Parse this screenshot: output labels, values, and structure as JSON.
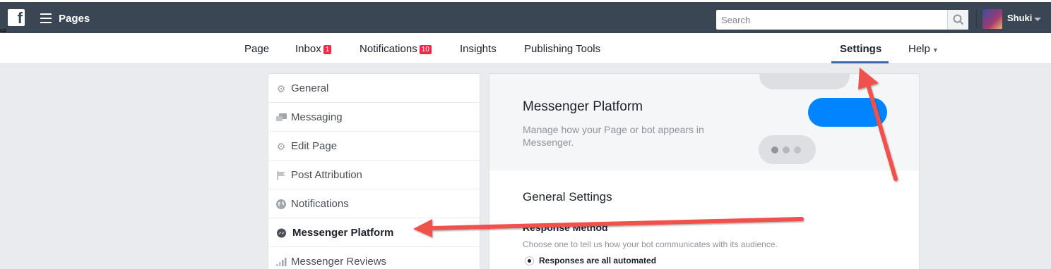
{
  "topbar": {
    "logo": "facebook-logo",
    "menu_icon": "hamburger-icon",
    "title": "Pages",
    "search_placeholder": "Search",
    "search_icon": "search-icon",
    "user_name": "Shuki",
    "user_caret_icon": "caret-down-icon"
  },
  "subnav": {
    "items": [
      {
        "label": "Page"
      },
      {
        "label": "Inbox",
        "badge": "1"
      },
      {
        "label": "Notifications",
        "badge": "10"
      },
      {
        "label": "Insights"
      },
      {
        "label": "Publishing Tools"
      },
      {
        "label": "Settings",
        "active": true
      },
      {
        "label": "Help"
      }
    ]
  },
  "sidebar": {
    "items": [
      {
        "label": "General",
        "icon": "gear-icon"
      },
      {
        "label": "Messaging",
        "icon": "chat-bubbles-icon"
      },
      {
        "label": "Edit Page",
        "icon": "gear-icon"
      },
      {
        "label": "Post Attribution",
        "icon": "flag-icon"
      },
      {
        "label": "Notifications",
        "icon": "globe-icon"
      },
      {
        "label": "Messenger Platform",
        "icon": "messenger-icon",
        "active": true
      },
      {
        "label": "Messenger Reviews",
        "icon": "signal-bars-icon"
      }
    ]
  },
  "main": {
    "hero_title": "Messenger Platform",
    "hero_description": "Manage how your Page or bot appears in Messenger.",
    "section_title": "General Settings",
    "field_label": "Response Method",
    "field_help": "Choose one to tell us how your bot communicates with its audience.",
    "radio_option": "Responses are all automated"
  },
  "colors": {
    "topbar": "#3b4654",
    "accent": "#4267b2",
    "badge": "#f02849",
    "messenger_blue": "#0084ff",
    "arrow": "#f0514b"
  }
}
